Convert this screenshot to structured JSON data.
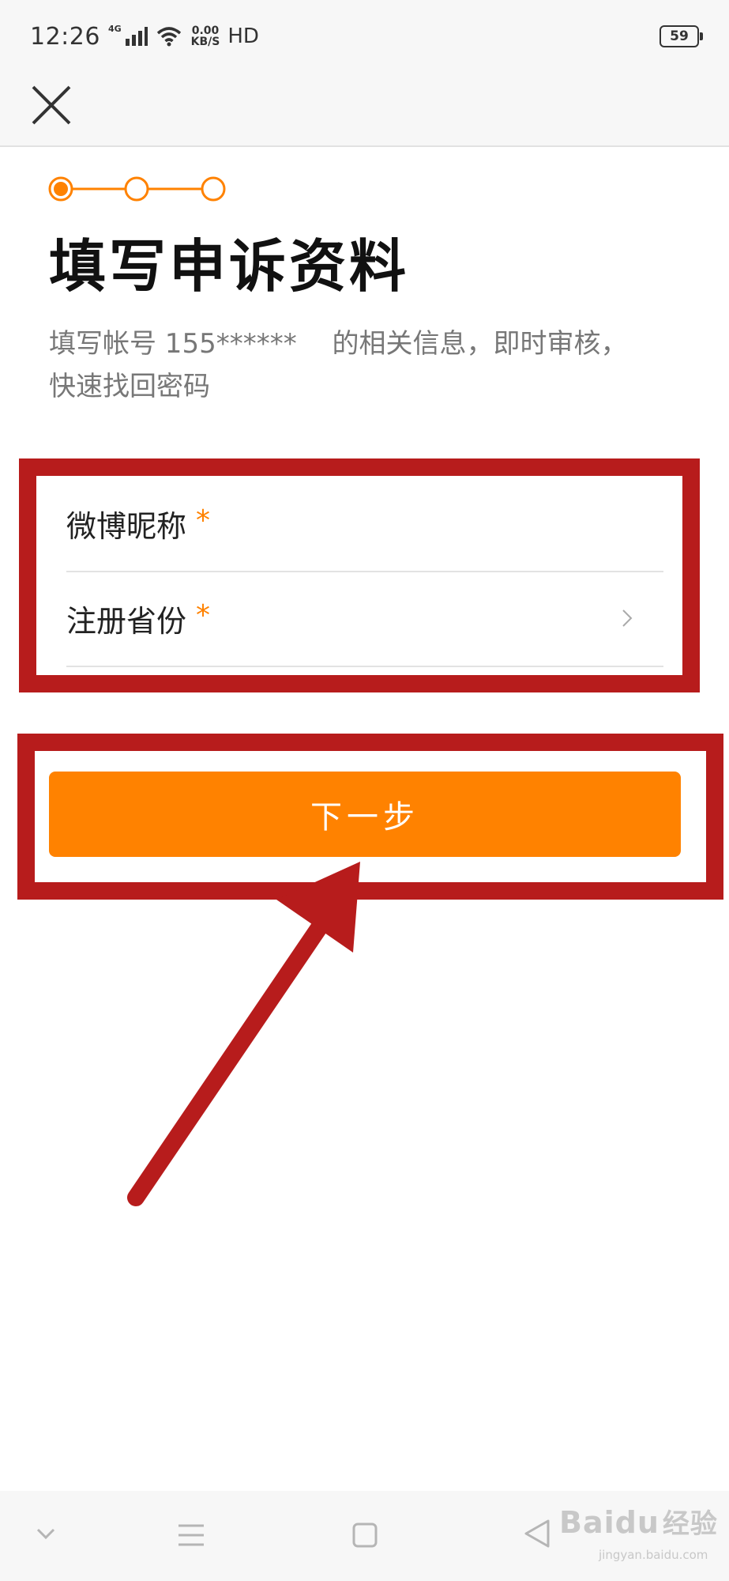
{
  "status_bar": {
    "time": "12:26",
    "network": "4G",
    "speed_value": "0.00",
    "speed_unit": "KB/S",
    "hd_label": "HD",
    "battery": "59"
  },
  "stepper": {
    "steps_total": 3,
    "current_step": 1
  },
  "page": {
    "title": "填写申诉资料",
    "subtitle": "填写帐号 155******　 的相关信息，即时审核，快速找回密码"
  },
  "form": {
    "nickname_label": "微博昵称",
    "province_label": "注册省份",
    "required_mark": "*"
  },
  "buttons": {
    "next_label": "下一步"
  },
  "watermark": {
    "brand": "Baidu",
    "brand_cn": "经验",
    "url": "jingyan.baidu.com"
  },
  "colors": {
    "accent": "#ff8200",
    "annotation": "#b71c1c",
    "bar_background": "#f7f7f7"
  },
  "icons": {
    "close": "close-icon",
    "chevron": "chevron-right-icon",
    "nav": [
      "chevron-down-icon",
      "menu-icon",
      "home-square-icon",
      "back-triangle-icon"
    ]
  }
}
